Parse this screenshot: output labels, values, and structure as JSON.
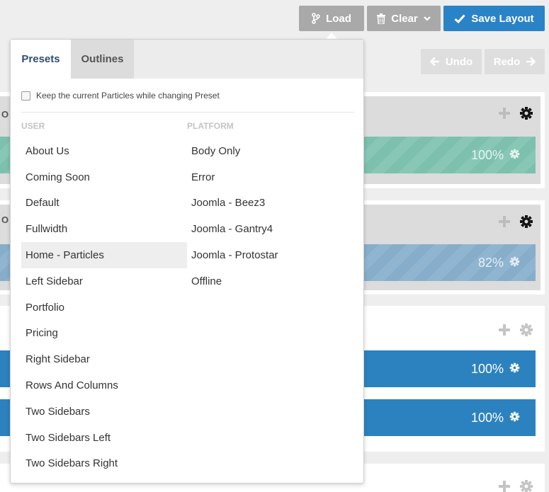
{
  "toolbar": {
    "load_label": "Load",
    "clear_label": "Clear",
    "save_label": "Save Layout",
    "undo_label": "Undo",
    "redo_label": "Redo"
  },
  "sections": {
    "sec1_label": "O",
    "sec2_label": "O",
    "bar_green_value": "100%",
    "bar_grey_value": "82%",
    "bar_blue1_value": "100%",
    "bar_blue2_value": "100%"
  },
  "dropdown": {
    "tabs": [
      "Presets",
      "Outlines"
    ],
    "keep_label": "Keep the current Particles while changing Preset",
    "user_heading": "USER",
    "platform_heading": "PLATFORM",
    "user_presets": [
      "About Us",
      "Coming Soon",
      "Default",
      "Fullwidth",
      "Home - Particles",
      "Left Sidebar",
      "Portfolio",
      "Pricing",
      "Right Sidebar",
      "Rows And Columns",
      "Two Sidebars",
      "Two Sidebars Left",
      "Two Sidebars Right"
    ],
    "platform_presets": [
      "Body Only",
      "Error",
      "Joomla - Beez3",
      "Joomla - Gantry4",
      "Joomla - Protostar",
      "Offline"
    ],
    "active_preset": "Home - Particles"
  },
  "colors": {
    "accent": "#2a83c7",
    "button_grey": "#a9a9a9"
  }
}
